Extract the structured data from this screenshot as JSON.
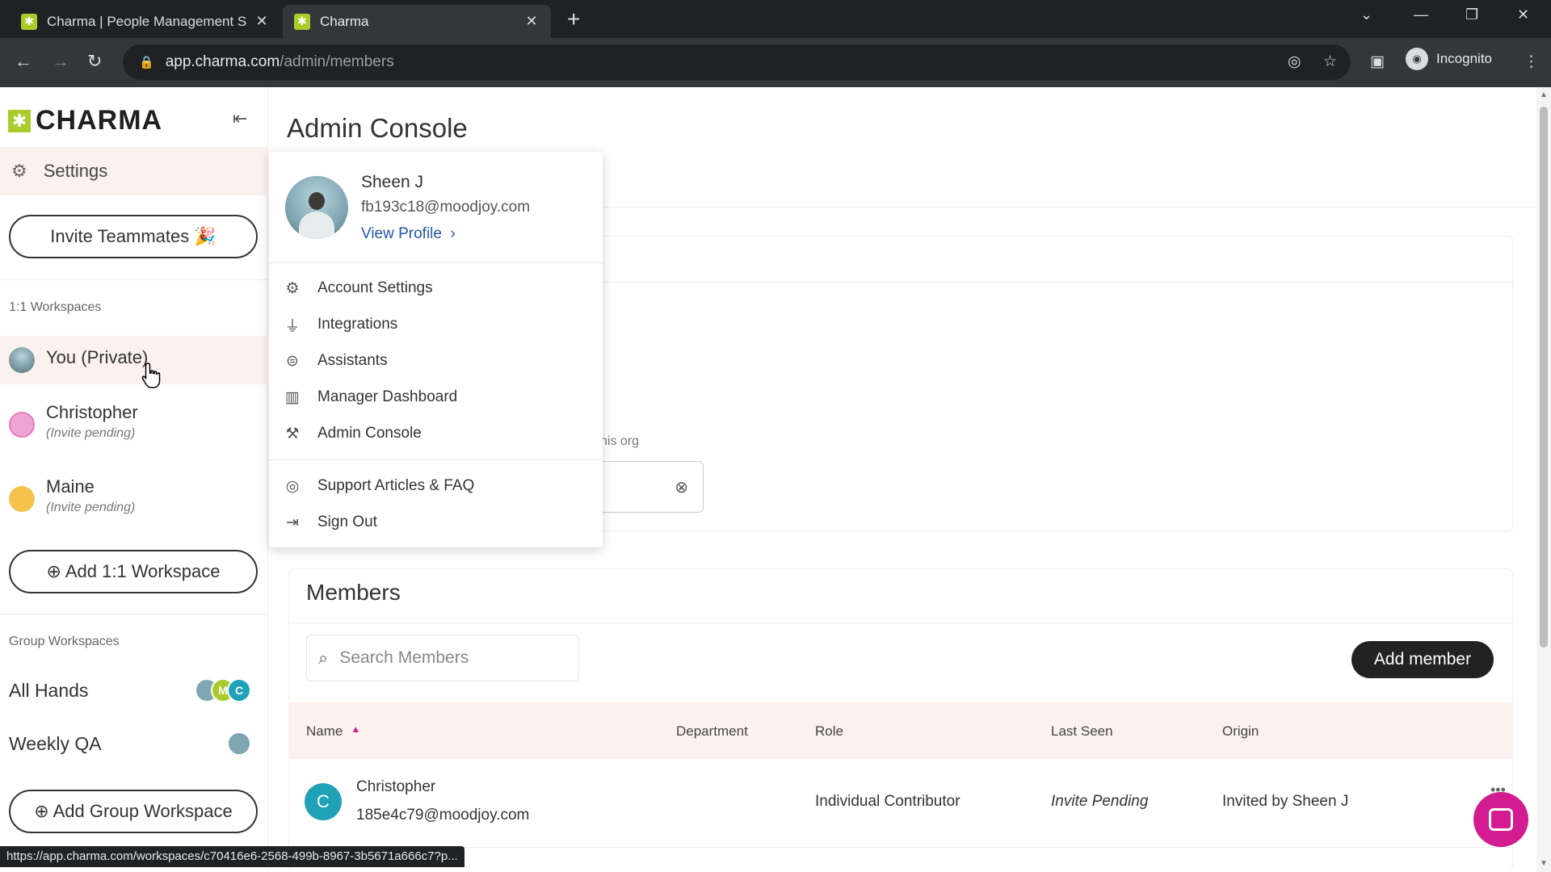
{
  "browser": {
    "tabs": [
      {
        "title": "Charma | People Management S",
        "active": false
      },
      {
        "title": "Charma",
        "active": true
      }
    ],
    "url_host": "app.charma.com",
    "url_path": "/admin/members",
    "profile_label": "Incognito",
    "status_url": "https://app.charma.com/workspaces/c70416e6-2568-499b-8967-3b5671a666c7?p..."
  },
  "sidebar": {
    "logo": "CHARMA",
    "settings_label": "Settings",
    "invite_label": "Invite Teammates 🎉",
    "one_on_one_heading": "1:1 Workspaces",
    "workspaces": [
      {
        "name": "You (Private)",
        "sub": ""
      },
      {
        "name": "Christopher",
        "sub": "(Invite pending)"
      },
      {
        "name": "Maine",
        "sub": "(Invite pending)"
      }
    ],
    "add_workspace_label": "⊕ Add 1:1 Workspace",
    "group_heading": "Group Workspaces",
    "groups": [
      {
        "name": "All Hands",
        "avatars": [
          "",
          "M",
          "C"
        ]
      },
      {
        "name": "Weekly QA",
        "avatars": [
          ""
        ]
      }
    ],
    "add_group_label": "⊕ Add Group Workspace"
  },
  "main": {
    "title": "Admin Console",
    "hint_text": "his org",
    "members_title": "Members",
    "search_placeholder": "Search Members",
    "add_member_label": "Add member",
    "columns": [
      "Name",
      "Department",
      "Role",
      "Last Seen",
      "Origin"
    ],
    "rows": [
      {
        "initial": "C",
        "name": "Christopher",
        "email": "185e4c79@moodjoy.com",
        "department": "",
        "role": "Individual Contributor",
        "last_seen": "Invite Pending",
        "origin": "Invited by Sheen J"
      }
    ]
  },
  "dropdown": {
    "user_name": "Sheen J",
    "user_email": "fb193c18@moodjoy.com",
    "view_profile": "View Profile",
    "items": [
      {
        "label": "Account Settings",
        "icon": "gear-icon"
      },
      {
        "label": "Integrations",
        "icon": "plug-icon"
      },
      {
        "label": "Assistants",
        "icon": "robot-icon"
      },
      {
        "label": "Manager Dashboard",
        "icon": "bar-chart-icon"
      },
      {
        "label": "Admin Console",
        "icon": "wrench-icon"
      }
    ],
    "items2": [
      {
        "label": "Support Articles & FAQ",
        "icon": "lifebuoy-icon"
      },
      {
        "label": "Sign Out",
        "icon": "sign-out-icon"
      }
    ]
  },
  "colors": {
    "brand": "#a9cc2b",
    "accent": "#d31c8f",
    "highlight_bg": "#fbf2ef",
    "row_avatar": "#1fa2b8",
    "link": "#2456a6"
  }
}
